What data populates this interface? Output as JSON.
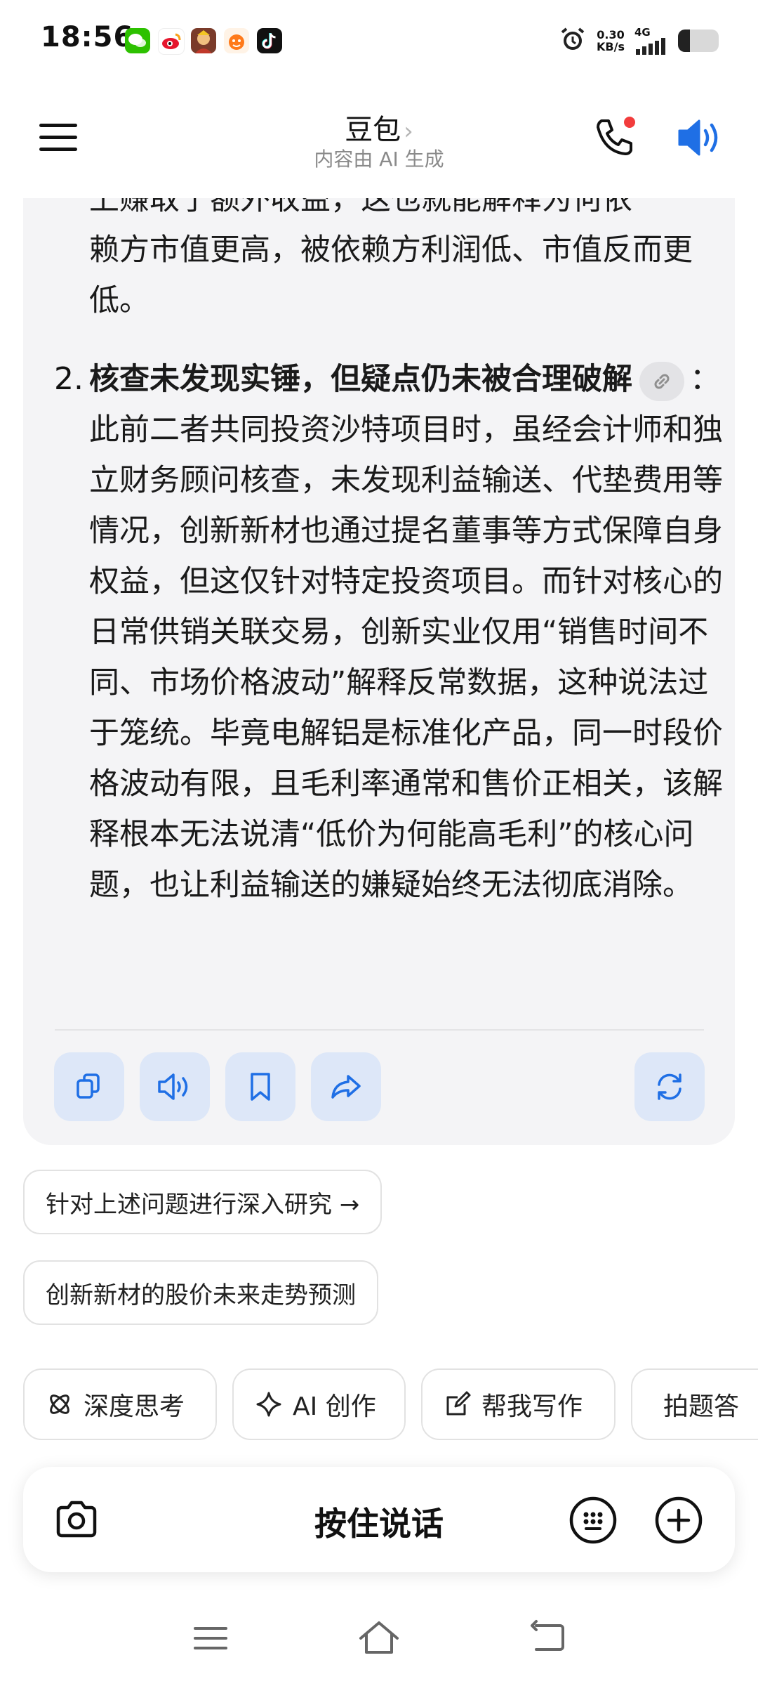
{
  "status_bar": {
    "time": "18:56",
    "apps": [
      "wechat-icon",
      "weibo-icon",
      "game-icon",
      "taobao-icon",
      "douyin-icon"
    ],
    "alarm_icon": "alarm-icon",
    "net_speed_value": "0.30",
    "net_speed_unit": "KB/s",
    "network": "4G",
    "battery_level": 0.3
  },
  "header": {
    "title": "豆包",
    "chevron": "›",
    "subtitle": "内容由 AI 生成"
  },
  "message": {
    "cropped_line": "上赚取了额外收益，这也就能解释为何依",
    "continuation": "赖方市值更高，被依赖方利润低、市值反而更低。",
    "item2": {
      "number": "2.",
      "heading": "核查未发现实锤，但疑点仍未被合理破解",
      "body": "：此前二者共同投资沙特项目时，虽经会计师和独立财务顾问核查，未发现利益输送、代垫费用等情况，创新新材也通过提名董事等方式保障自身权益，但这仅针对特定投资项目。而针对核心的日常供销关联交易，创新实业仅用“销售时间不同、市场价格波动”解释反常数据，这种说法过于笼统。毕竟电解铝是标准化产品，同一时段价格波动有限，且毛利率通常和售价正相关，该解释根本无法说清“低价为何能高毛利”的核心问题，也让利益输送的嫌疑始终无法彻底消除。"
    }
  },
  "suggestions": [
    {
      "label": "针对上述问题进行深入研究 →"
    },
    {
      "label": "创新新材的股价未来走势预测"
    }
  ],
  "chips": [
    {
      "label": "深度思考"
    },
    {
      "label": "AI 创作"
    },
    {
      "label": "帮我写作"
    },
    {
      "label": "拍题答"
    }
  ],
  "input": {
    "hold_to_talk": "按住说话"
  },
  "colors": {
    "accent": "#1f6fe5",
    "action_bg": "#dde7f8",
    "card_bg": "#f4f4f6",
    "notification_dot": "#f23c3c"
  }
}
